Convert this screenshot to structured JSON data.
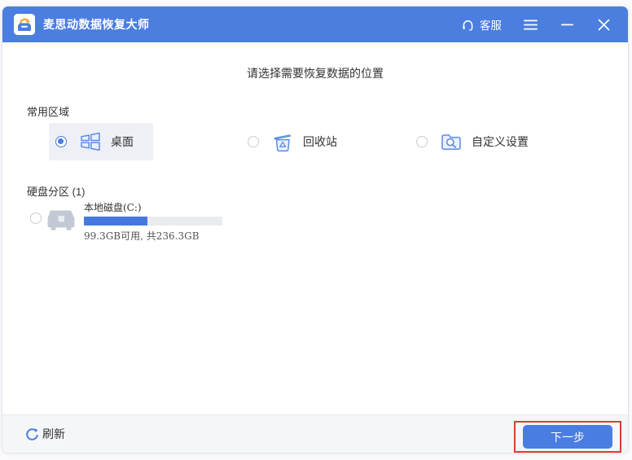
{
  "window": {
    "title": "麦思动数据恢复大师",
    "titlebar": {
      "support_label": "客服"
    }
  },
  "main": {
    "heading": "请选择需要恢复数据的位置",
    "common_section": {
      "label": "常用区域",
      "options": [
        {
          "label": "桌面",
          "selected": true
        },
        {
          "label": "回收站",
          "selected": false
        },
        {
          "label": "自定义设置",
          "selected": false
        }
      ]
    },
    "partition_section": {
      "label": "硬盘分区 (1)",
      "disks": [
        {
          "name": "本地磁盘(C:)",
          "capacity": "99.3GB可用, 共236.3GB",
          "used_percent": 46,
          "selected": false
        }
      ]
    }
  },
  "footer": {
    "refresh_label": "刷新",
    "next_label": "下一步"
  },
  "icons": {
    "app_logo": "recovery-arrow-tray",
    "support": "headset-icon",
    "menu": "hamburger-menu-icon",
    "minimize": "minimize-icon",
    "close": "close-icon",
    "desktop": "windows-grid-icon",
    "recycle": "recycle-bin-icon",
    "custom": "folder-search-icon",
    "disk": "hard-drive-icon",
    "refresh": "refresh-icon"
  },
  "colors": {
    "titlebar": "#4c7ee0",
    "accent": "#4a7de0",
    "icon_blue": "#5b8ce4",
    "annotation": "#e23b35",
    "selected_option_bg": "#eef0f5"
  }
}
